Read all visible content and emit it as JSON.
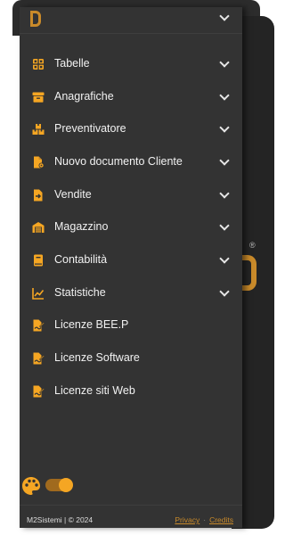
{
  "menu": {
    "items": [
      {
        "label": "Tabelle",
        "icon": "table-icon",
        "expandable": true
      },
      {
        "label": "Anagrafiche",
        "icon": "archive-box-icon",
        "expandable": true
      },
      {
        "label": "Preventivatore",
        "icon": "boxes-icon",
        "expandable": true
      },
      {
        "label": "Nuovo documento Cliente",
        "icon": "file-settings-icon",
        "expandable": true
      },
      {
        "label": "Vendite",
        "icon": "file-export-icon",
        "expandable": true
      },
      {
        "label": "Magazzino",
        "icon": "warehouse-icon",
        "expandable": true
      },
      {
        "label": "Contabilità",
        "icon": "ledger-book-icon",
        "expandable": true
      },
      {
        "label": "Statistiche",
        "icon": "line-chart-icon",
        "expandable": true
      },
      {
        "label": "Licenze BEE.P",
        "icon": "file-signature-icon",
        "expandable": false
      },
      {
        "label": "Licenze Software",
        "icon": "file-signature-icon",
        "expandable": false
      },
      {
        "label": "Licenze siti Web",
        "icon": "file-signature-icon",
        "expandable": false
      }
    ]
  },
  "theme": {
    "accent": "#f5a623",
    "panel": "#333333",
    "dark_mode": true
  },
  "footer": {
    "copyright": "M2Sistemi | © 2024",
    "privacy": "Privacy",
    "separator": "·",
    "credits": "Credits"
  },
  "background": {
    "registered_mark": "®"
  }
}
